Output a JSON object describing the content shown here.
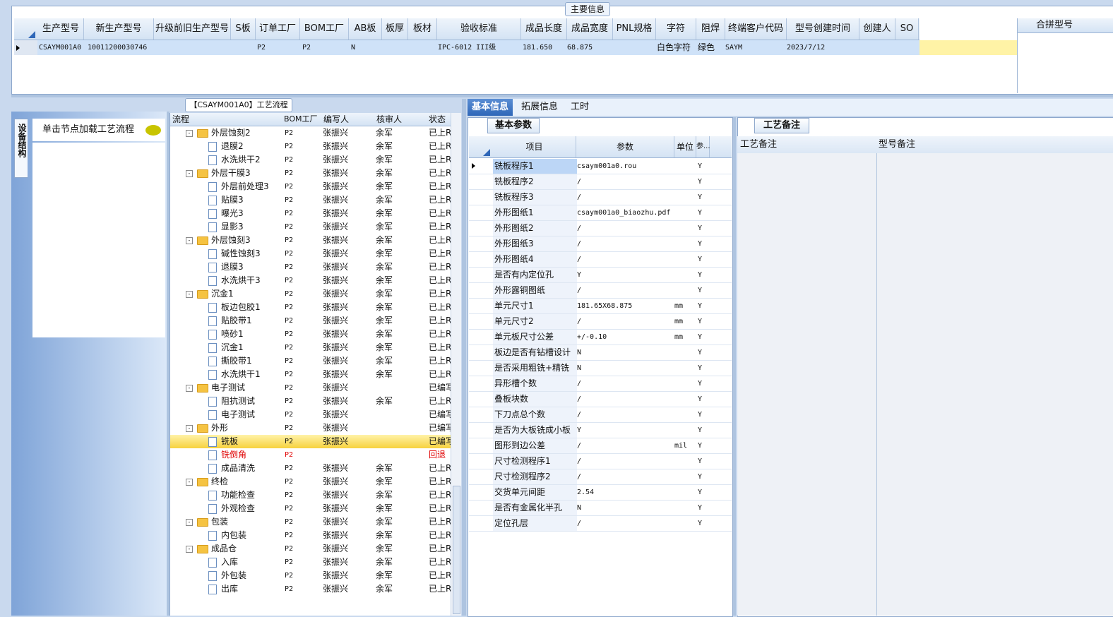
{
  "top": {
    "tab_label": "主要信息",
    "columns": [
      "生产型号",
      "新生产型号",
      "升级前旧生产型号",
      "S板",
      "订单工厂",
      "BOM工厂",
      "AB板",
      "板厚",
      "板材",
      "验收标准",
      "成品长度",
      "成品宽度",
      "PNL规格",
      "字符",
      "阻焊",
      "终端客户代码",
      "型号创建时间",
      "创建人",
      "SO"
    ],
    "row": [
      "CSAYM001A0",
      "10011200030746",
      "",
      "",
      "P2",
      "P2",
      "N",
      "",
      "",
      "IPC-6012 III级",
      "181.650",
      "68.875",
      "",
      "白色字符",
      "绿色",
      "SAYM",
      "2023/7/12",
      "",
      ""
    ],
    "merge_header": "合拼型号"
  },
  "left": {
    "vertical_tab": "设备结构",
    "node_load_text": "单击节点加载工艺流程"
  },
  "flow": {
    "title": "【CSAYM001A0】工艺流程",
    "columns": [
      "流程",
      "BOM工厂",
      "编写人",
      "核审人",
      "状态"
    ],
    "rows": [
      {
        "level": 1,
        "name": "外层蚀刻2",
        "bom": "P2",
        "writer": "张振兴",
        "reviewer": "余军",
        "status": "已上RI"
      },
      {
        "level": 2,
        "name": "退膜2",
        "bom": "P2",
        "writer": "张振兴",
        "reviewer": "余军",
        "status": "已上RI"
      },
      {
        "level": 2,
        "name": "水洗烘干2",
        "bom": "P2",
        "writer": "张振兴",
        "reviewer": "余军",
        "status": "已上RI"
      },
      {
        "level": 1,
        "name": "外层干膜3",
        "bom": "P2",
        "writer": "张振兴",
        "reviewer": "余军",
        "status": "已上RI"
      },
      {
        "level": 2,
        "name": "外层前处理3",
        "bom": "P2",
        "writer": "张振兴",
        "reviewer": "余军",
        "status": "已上RI"
      },
      {
        "level": 2,
        "name": "贴膜3",
        "bom": "P2",
        "writer": "张振兴",
        "reviewer": "余军",
        "status": "已上RI"
      },
      {
        "level": 2,
        "name": "曝光3",
        "bom": "P2",
        "writer": "张振兴",
        "reviewer": "余军",
        "status": "已上RI"
      },
      {
        "level": 2,
        "name": "显影3",
        "bom": "P2",
        "writer": "张振兴",
        "reviewer": "余军",
        "status": "已上RI"
      },
      {
        "level": 1,
        "name": "外层蚀刻3",
        "bom": "P2",
        "writer": "张振兴",
        "reviewer": "余军",
        "status": "已上RI"
      },
      {
        "level": 2,
        "name": "碱性蚀刻3",
        "bom": "P2",
        "writer": "张振兴",
        "reviewer": "余军",
        "status": "已上RI"
      },
      {
        "level": 2,
        "name": "退膜3",
        "bom": "P2",
        "writer": "张振兴",
        "reviewer": "余军",
        "status": "已上RI"
      },
      {
        "level": 2,
        "name": "水洗烘干3",
        "bom": "P2",
        "writer": "张振兴",
        "reviewer": "余军",
        "status": "已上RI"
      },
      {
        "level": 1,
        "name": "沉金1",
        "bom": "P2",
        "writer": "张振兴",
        "reviewer": "余军",
        "status": "已上RI"
      },
      {
        "level": 2,
        "name": "板边包胶1",
        "bom": "P2",
        "writer": "张振兴",
        "reviewer": "余军",
        "status": "已上RI"
      },
      {
        "level": 2,
        "name": "贴胶带1",
        "bom": "P2",
        "writer": "张振兴",
        "reviewer": "余军",
        "status": "已上RI"
      },
      {
        "level": 2,
        "name": "喷砂1",
        "bom": "P2",
        "writer": "张振兴",
        "reviewer": "余军",
        "status": "已上RI"
      },
      {
        "level": 2,
        "name": "沉金1",
        "bom": "P2",
        "writer": "张振兴",
        "reviewer": "余军",
        "status": "已上RI"
      },
      {
        "level": 2,
        "name": "撕胶带1",
        "bom": "P2",
        "writer": "张振兴",
        "reviewer": "余军",
        "status": "已上RI"
      },
      {
        "level": 2,
        "name": "水洗烘干1",
        "bom": "P2",
        "writer": "张振兴",
        "reviewer": "余军",
        "status": "已上RI"
      },
      {
        "level": 1,
        "name": "电子测试",
        "bom": "P2",
        "writer": "张振兴",
        "reviewer": "",
        "status": "已编写"
      },
      {
        "level": 2,
        "name": "阻抗测试",
        "bom": "P2",
        "writer": "张振兴",
        "reviewer": "余军",
        "status": "已上RI"
      },
      {
        "level": 2,
        "name": "电子测试",
        "bom": "P2",
        "writer": "张振兴",
        "reviewer": "",
        "status": "已编写"
      },
      {
        "level": 1,
        "name": "外形",
        "bom": "P2",
        "writer": "张振兴",
        "reviewer": "",
        "status": "已编写"
      },
      {
        "level": 2,
        "name": "铣板",
        "bom": "P2",
        "writer": "张振兴",
        "reviewer": "",
        "status": "已编写",
        "highlight": true
      },
      {
        "level": 2,
        "name": "铣倒角",
        "bom": "P2",
        "writer": "",
        "reviewer": "",
        "status": "回退",
        "rejected": true
      },
      {
        "level": 2,
        "name": "成品清洗",
        "bom": "P2",
        "writer": "张振兴",
        "reviewer": "余军",
        "status": "已上RI"
      },
      {
        "level": 1,
        "name": "终检",
        "bom": "P2",
        "writer": "张振兴",
        "reviewer": "余军",
        "status": "已上RI"
      },
      {
        "level": 2,
        "name": "功能检查",
        "bom": "P2",
        "writer": "张振兴",
        "reviewer": "余军",
        "status": "已上RI"
      },
      {
        "level": 2,
        "name": "外观检查",
        "bom": "P2",
        "writer": "张振兴",
        "reviewer": "余军",
        "status": "已上RI"
      },
      {
        "level": 1,
        "name": "包装",
        "bom": "P2",
        "writer": "张振兴",
        "reviewer": "余军",
        "status": "已上RI"
      },
      {
        "level": 2,
        "name": "内包装",
        "bom": "P2",
        "writer": "张振兴",
        "reviewer": "余军",
        "status": "已上RI"
      },
      {
        "level": 1,
        "name": "成品仓",
        "bom": "P2",
        "writer": "张振兴",
        "reviewer": "余军",
        "status": "已上RI"
      },
      {
        "level": 2,
        "name": "入库",
        "bom": "P2",
        "writer": "张振兴",
        "reviewer": "余军",
        "status": "已上RI"
      },
      {
        "level": 2,
        "name": "外包装",
        "bom": "P2",
        "writer": "张振兴",
        "reviewer": "余军",
        "status": "已上RI"
      },
      {
        "level": 2,
        "name": "出库",
        "bom": "P2",
        "writer": "张振兴",
        "reviewer": "余军",
        "status": "已上RI"
      }
    ]
  },
  "right": {
    "tabs": [
      "基本信息",
      "拓展信息",
      "工时"
    ],
    "params_subtab": "基本参数",
    "params_columns": [
      "项目",
      "参数",
      "单位",
      "参..."
    ],
    "params": [
      {
        "item": "铣板程序1",
        "value": "csaym001a0.rou",
        "unit": "",
        "flag": "Y"
      },
      {
        "item": "铣板程序2",
        "value": "/",
        "unit": "",
        "flag": "Y"
      },
      {
        "item": "铣板程序3",
        "value": "/",
        "unit": "",
        "flag": "Y"
      },
      {
        "item": "外形图纸1",
        "value": "csaym001a0_biaozhu.pdf",
        "unit": "",
        "flag": "Y"
      },
      {
        "item": "外形图纸2",
        "value": "/",
        "unit": "",
        "flag": "Y"
      },
      {
        "item": "外形图纸3",
        "value": "/",
        "unit": "",
        "flag": "Y"
      },
      {
        "item": "外形图纸4",
        "value": "/",
        "unit": "",
        "flag": "Y"
      },
      {
        "item": "是否有内定位孔",
        "value": "Y",
        "unit": "",
        "flag": "Y"
      },
      {
        "item": "外形露铜图纸",
        "value": "/",
        "unit": "",
        "flag": "Y"
      },
      {
        "item": "单元尺寸1",
        "value": "181.65X68.875",
        "unit": "mm",
        "flag": "Y"
      },
      {
        "item": "单元尺寸2",
        "value": "/",
        "unit": "mm",
        "flag": "Y"
      },
      {
        "item": "单元板尺寸公差",
        "value": "+/-0.10",
        "unit": "mm",
        "flag": "Y"
      },
      {
        "item": "板边是否有钻槽设计",
        "value": "N",
        "unit": "",
        "flag": "Y"
      },
      {
        "item": "是否采用粗铣+精铣",
        "value": "N",
        "unit": "",
        "flag": "Y"
      },
      {
        "item": "异形槽个数",
        "value": "/",
        "unit": "",
        "flag": "Y"
      },
      {
        "item": "叠板块数",
        "value": "/",
        "unit": "",
        "flag": "Y"
      },
      {
        "item": "下刀点总个数",
        "value": "/",
        "unit": "",
        "flag": "Y"
      },
      {
        "item": "是否为大板铣成小板",
        "value": "Y",
        "unit": "",
        "flag": "Y"
      },
      {
        "item": "图形到边公差",
        "value": "/",
        "unit": "mil",
        "flag": "Y"
      },
      {
        "item": "尺寸检测程序1",
        "value": "/",
        "unit": "",
        "flag": "Y"
      },
      {
        "item": "尺寸检测程序2",
        "value": "/",
        "unit": "",
        "flag": "Y"
      },
      {
        "item": "交货单元间距",
        "value": "2.54",
        "unit": "",
        "flag": "Y"
      },
      {
        "item": "是否有金属化半孔",
        "value": "N",
        "unit": "",
        "flag": "Y"
      },
      {
        "item": "定位孔层",
        "value": "/",
        "unit": "",
        "flag": "Y"
      }
    ],
    "notes_subtab": "工艺备注",
    "notes_columns": [
      "工艺备注",
      "型号备注"
    ]
  },
  "colors": {
    "accent": "#2f67b8",
    "highlight": "#f7d23e",
    "rejected": "#e00000"
  }
}
